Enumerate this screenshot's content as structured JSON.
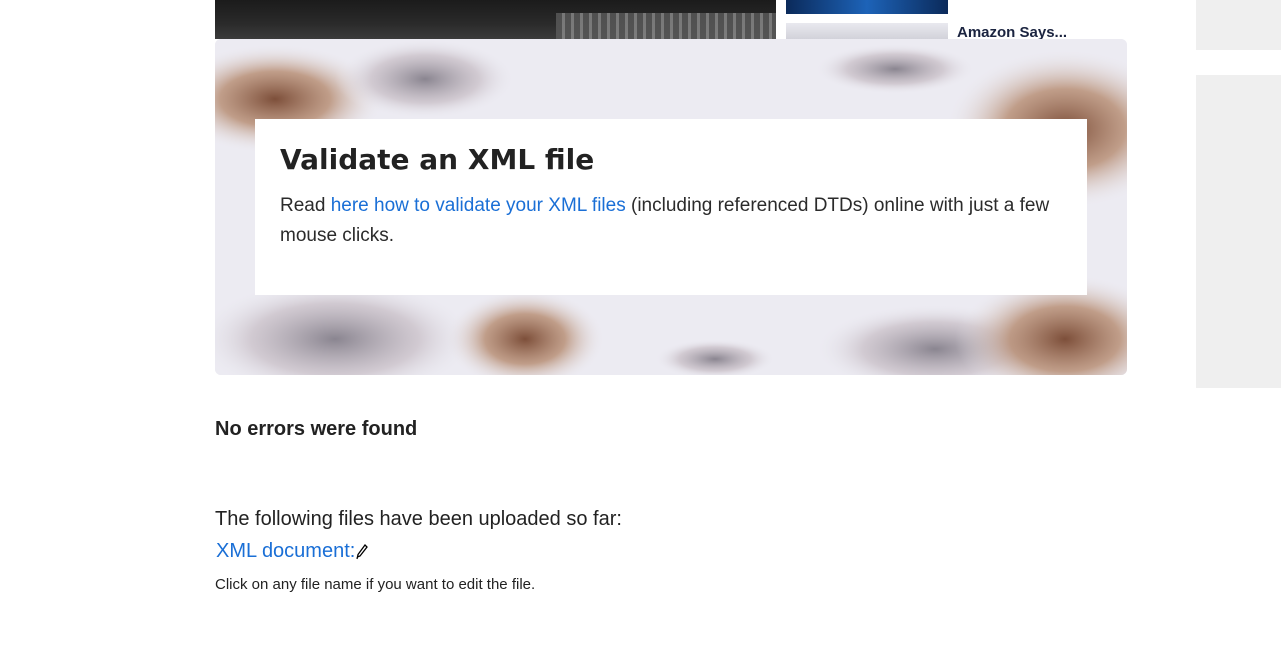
{
  "news": {
    "headline": "Amazon Says..."
  },
  "hero": {
    "title": "Validate an XML file",
    "text_before": "Read ",
    "link_text": "here how to validate your XML files",
    "text_after": " (including referenced DTDs) online with just a few mouse clicks."
  },
  "result": {
    "status": "No errors were found"
  },
  "files": {
    "intro": "The following files have been uploaded so far:",
    "items": [
      {
        "label": "XML document:",
        "icon": "pencil-icon"
      }
    ],
    "hint": "Click on any file name if you want to edit the file."
  },
  "colors": {
    "link": "#1a6fd6",
    "hero_bg": "#ecebf2",
    "sidebar_placeholder": "#efefef"
  }
}
